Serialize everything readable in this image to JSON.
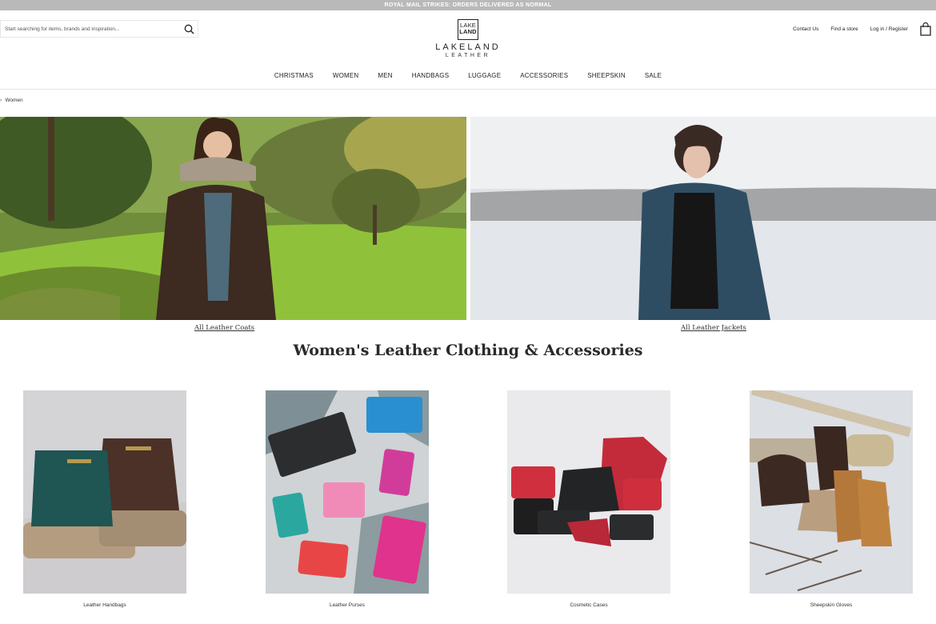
{
  "announcement": "ROYAL MAIL STRIKES: ORDERS DELIVERED AS NORMAL",
  "search": {
    "placeholder": "Start searching for items, brands and inspiration...",
    "icon": "search-icon"
  },
  "logo": {
    "box_line1": "LAKE",
    "box_line2": "LAND",
    "word1": "LAKELAND",
    "word2": "LEATHER"
  },
  "utility": {
    "contact": "Contact Us",
    "store": "Find a store",
    "login": "Log in / Register",
    "bag_icon": "shopping-bag-icon"
  },
  "nav": [
    "CHRISTMAS",
    "WOMEN",
    "MEN",
    "HANDBAGS",
    "LUGGAGE",
    "ACCESSORIES",
    "SHEEPSKIN",
    "SALE"
  ],
  "breadcrumb": {
    "current": "Women"
  },
  "heroes": [
    {
      "link": "All Leather Coats"
    },
    {
      "link": "All Leather Jackets"
    }
  ],
  "headline": "Women's Leather Clothing & Accessories",
  "categories": [
    {
      "label": "Leather Handbags"
    },
    {
      "label": "Leather Purses"
    },
    {
      "label": "Cosmetic Cases"
    },
    {
      "label": "Sheepskin Gloves"
    }
  ]
}
